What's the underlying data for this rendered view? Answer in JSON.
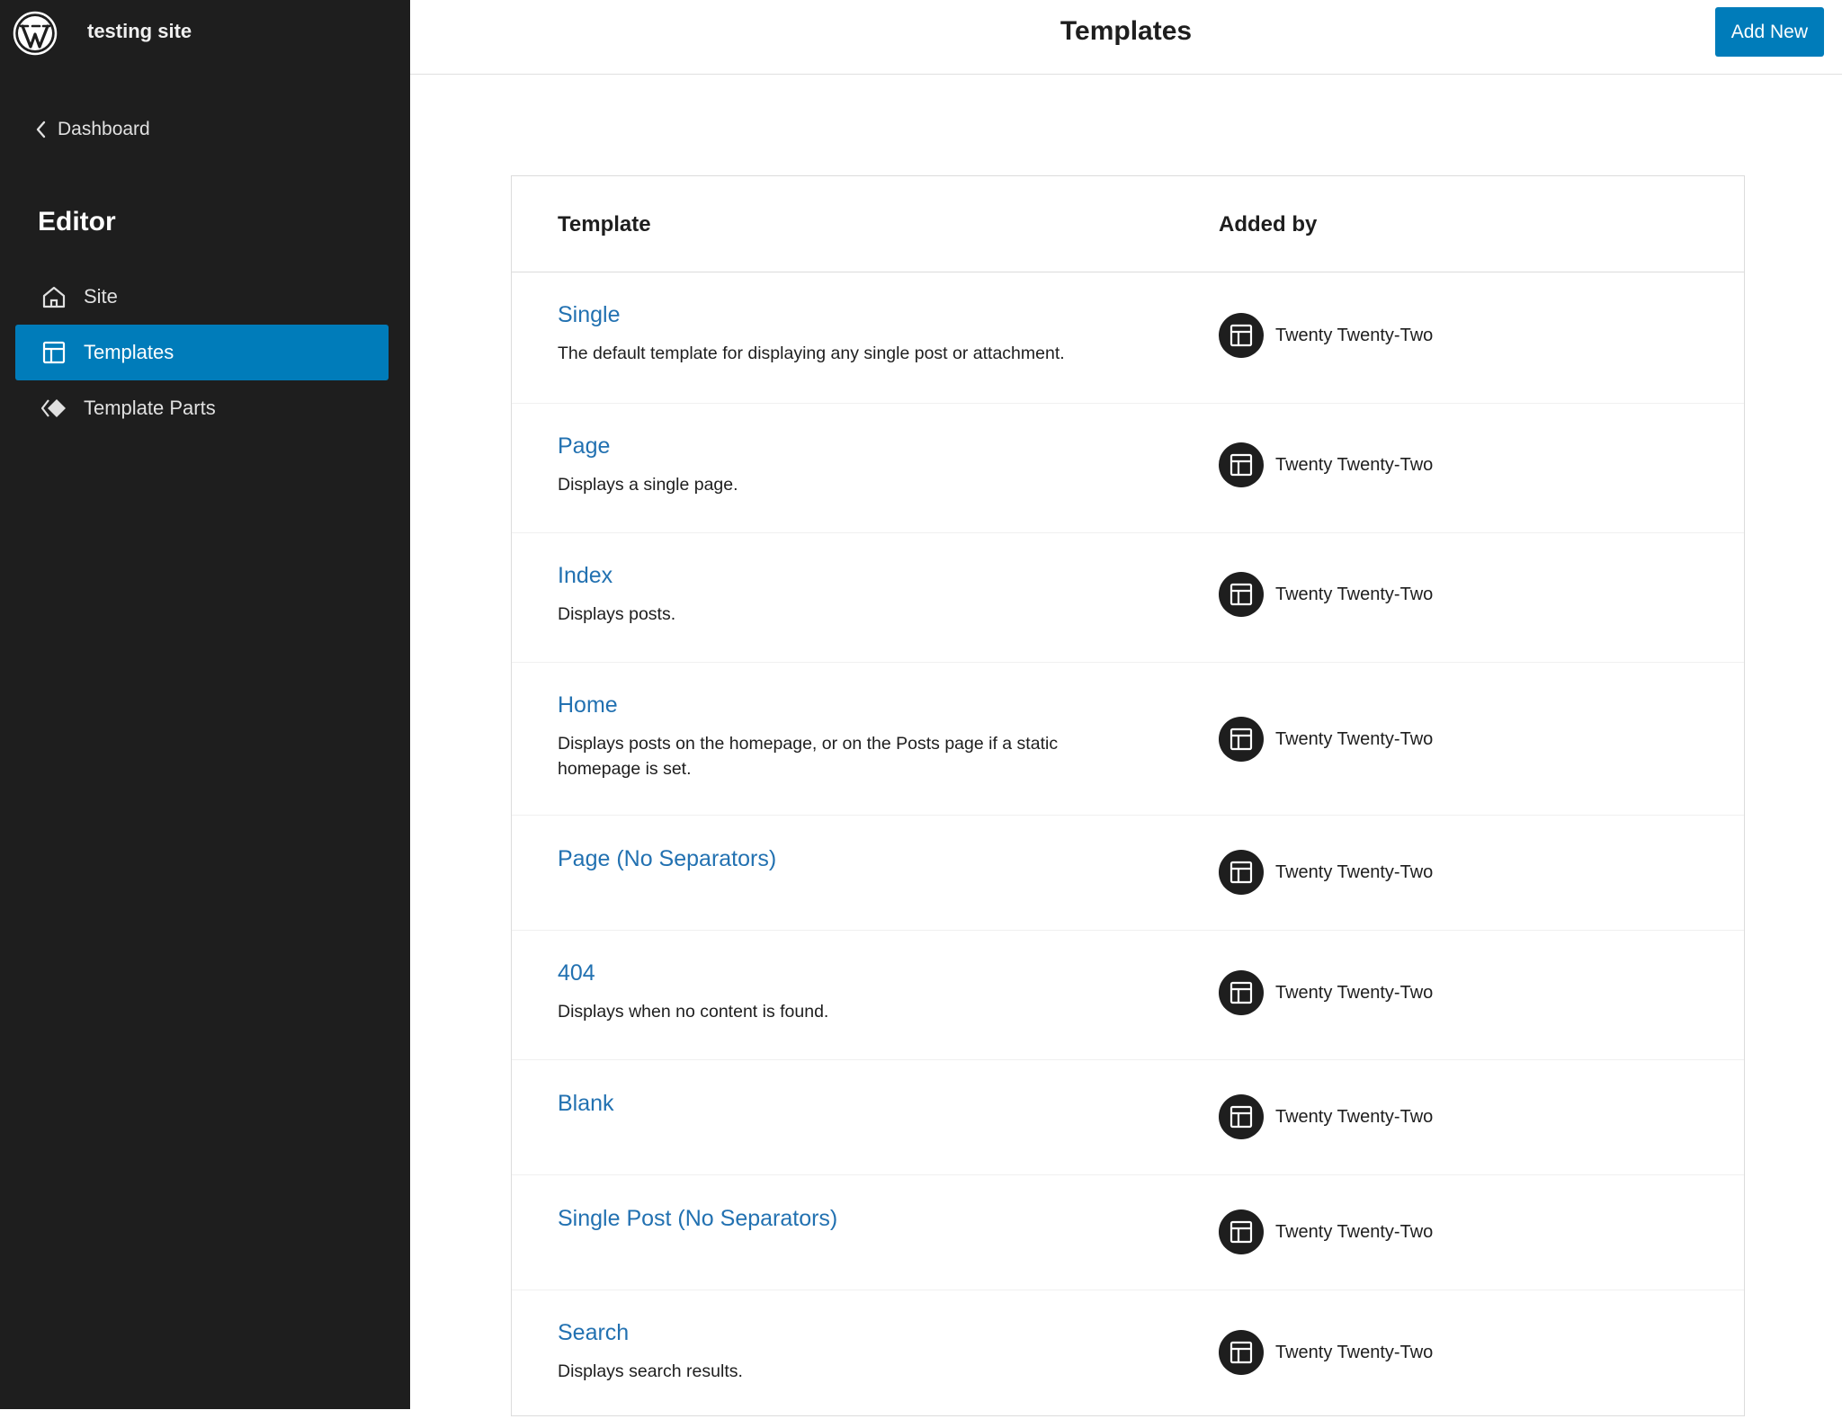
{
  "sidebar": {
    "site_name": "testing site",
    "back_label": "Dashboard",
    "section_title": "Editor",
    "nav": [
      {
        "label": "Site",
        "icon": "home-icon",
        "active": false
      },
      {
        "label": "Templates",
        "icon": "layout-icon",
        "active": true
      },
      {
        "label": "Template Parts",
        "icon": "symbol-filled-icon",
        "active": false
      }
    ]
  },
  "header": {
    "title": "Templates",
    "add_new_label": "Add New"
  },
  "table": {
    "columns": [
      "Template",
      "Added by"
    ],
    "rows": [
      {
        "name": "Single",
        "description": "The default template for displaying any single post or attachment.",
        "added_by": "Twenty Twenty-Two"
      },
      {
        "name": "Page",
        "description": "Displays a single page.",
        "added_by": "Twenty Twenty-Two"
      },
      {
        "name": "Index",
        "description": "Displays posts.",
        "added_by": "Twenty Twenty-Two"
      },
      {
        "name": "Home",
        "description": "Displays posts on the homepage, or on the Posts page if a static homepage is set.",
        "added_by": "Twenty Twenty-Two"
      },
      {
        "name": "Page (No Separators)",
        "description": "",
        "added_by": "Twenty Twenty-Two"
      },
      {
        "name": "404",
        "description": "Displays when no content is found.",
        "added_by": "Twenty Twenty-Two"
      },
      {
        "name": "Blank",
        "description": "",
        "added_by": "Twenty Twenty-Two"
      },
      {
        "name": "Single Post (No Separators)",
        "description": "",
        "added_by": "Twenty Twenty-Two"
      },
      {
        "name": "Search",
        "description": "Displays search results.",
        "added_by": "Twenty Twenty-Two"
      }
    ]
  },
  "colors": {
    "sidebar_bg": "#1e1e1e",
    "accent": "#007cba",
    "link": "#2271b1"
  }
}
